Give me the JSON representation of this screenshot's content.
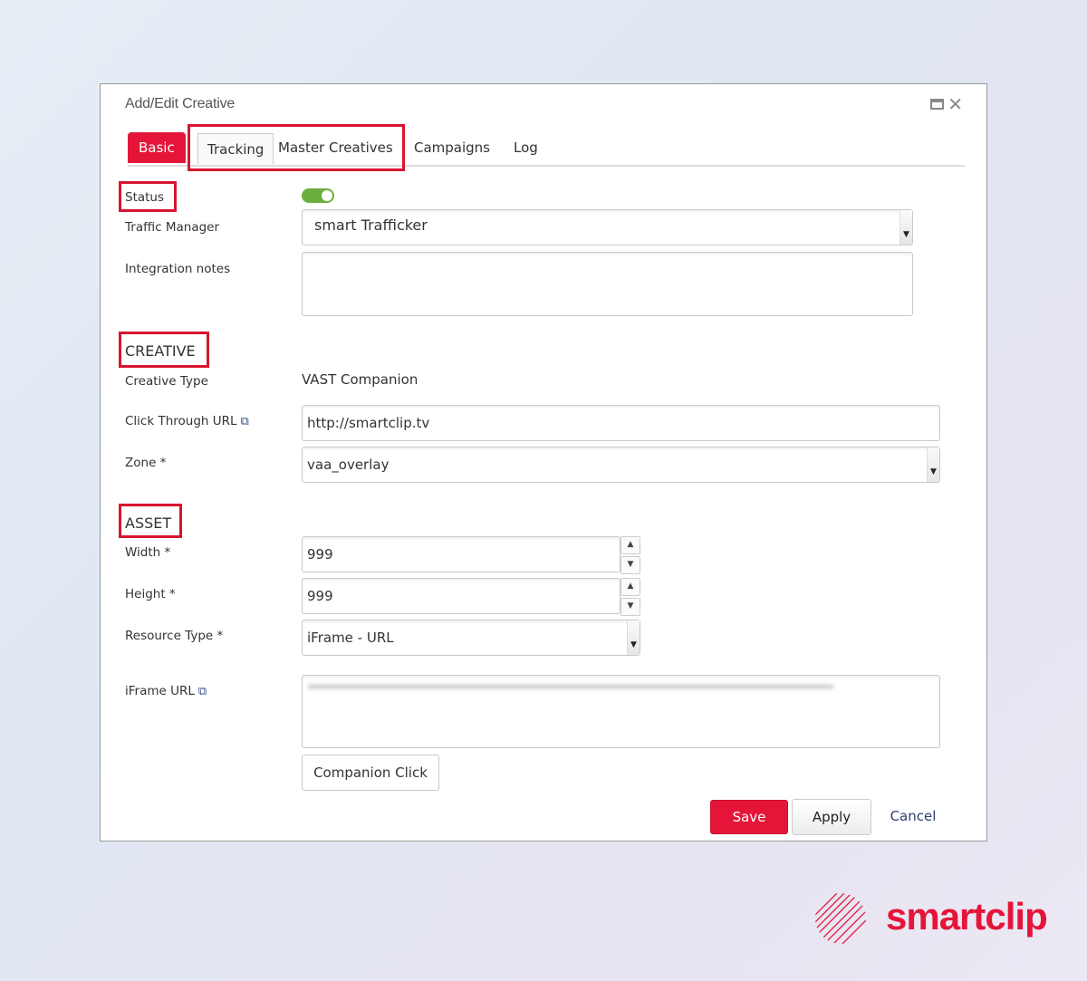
{
  "dialog": {
    "title": "Add/Edit Creative",
    "window_controls": [
      "maximize-icon",
      "close-icon"
    ]
  },
  "tabs": [
    {
      "label": "Basic",
      "active": true
    },
    {
      "label": "Tracking",
      "active": false
    },
    {
      "label": "Master Creatives",
      "active": false
    },
    {
      "label": "Campaigns",
      "active": false
    },
    {
      "label": "Log",
      "active": false
    }
  ],
  "form": {
    "status_label": "Status",
    "status_on": true,
    "traffic_manager_label": "Traffic Manager",
    "traffic_manager_value": "smart Trafficker",
    "integration_notes_label": "Integration notes",
    "integration_notes_value": "",
    "creative_section": "CREATIVE",
    "creative_type_label": "Creative Type",
    "creative_type_value": "VAST Companion",
    "click_through_label": "Click Through URL",
    "click_through_value": "http://smartclip.tv",
    "zone_label": "Zone *",
    "zone_value": "vaa_overlay",
    "asset_section": "ASSET",
    "width_label": "Width *",
    "width_value": "999",
    "height_label": "Height *",
    "height_value": "999",
    "resource_type_label": "Resource Type *",
    "resource_type_value": "iFrame - URL",
    "iframe_url_label": "iFrame URL",
    "iframe_url_value": "",
    "companion_click_label": "Companion Click"
  },
  "buttons": {
    "save": "Save",
    "apply": "Apply",
    "cancel": "Cancel"
  },
  "brand": {
    "name": "smartclip",
    "accent_color": "#e5153a",
    "highlight_color": "#d7152e",
    "toggle_color": "#6cae3e"
  },
  "icons": {
    "external_link": "external-link-icon",
    "maximize": "maximize-icon",
    "close": "close-icon"
  }
}
